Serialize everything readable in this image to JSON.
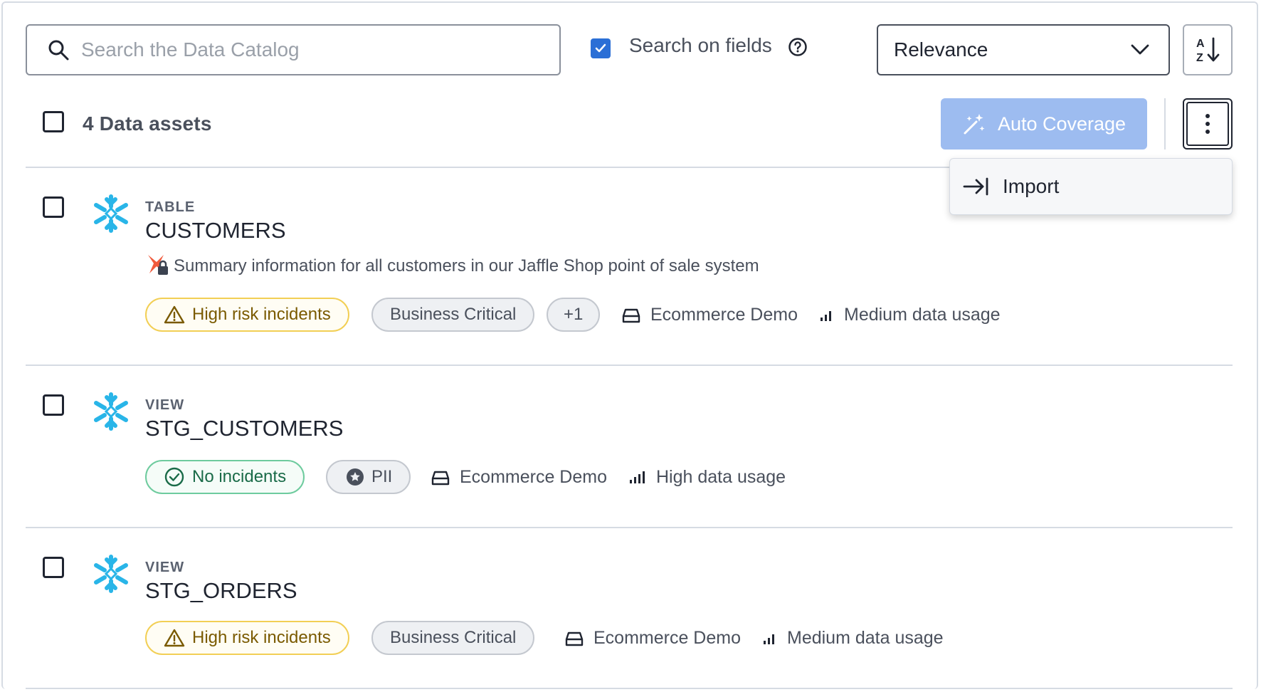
{
  "toolbar": {
    "search_placeholder": "Search the Data Catalog",
    "search_on_fields_label": "Search on fields",
    "search_on_fields_checked": true,
    "sort_value": "Relevance"
  },
  "list_header": {
    "assets_count": "4 Data assets",
    "auto_coverage_label": "Auto Coverage"
  },
  "menu": {
    "import_label": "Import"
  },
  "colors": {
    "accent": "#2b6fd6",
    "auto_coverage_disabled": "#9dbcf0",
    "snowflake": "#29b5e8",
    "warning": "#f2cf55",
    "success": "#6ecb9e"
  },
  "assets": [
    {
      "type": "TABLE",
      "name": "CUSTOMERS",
      "icon": "snowflake-icon",
      "description": "Summary information for all customers in our Jaffle Shop point of sale system",
      "incident": "High risk incidents",
      "tags": [
        "Business Critical",
        "+1"
      ],
      "source": "Ecommerce Demo",
      "usage": "Medium data usage"
    },
    {
      "type": "VIEW",
      "name": "STG_CUSTOMERS",
      "icon": "snowflake-icon",
      "incident": "No incidents",
      "tags": [
        "PII"
      ],
      "source": "Ecommerce Demo",
      "usage": "High data usage"
    },
    {
      "type": "VIEW",
      "name": "STG_ORDERS",
      "icon": "snowflake-icon",
      "incident": "High risk incidents",
      "tags": [
        "Business Critical"
      ],
      "source": "Ecommerce Demo",
      "usage": "Medium data usage"
    }
  ]
}
